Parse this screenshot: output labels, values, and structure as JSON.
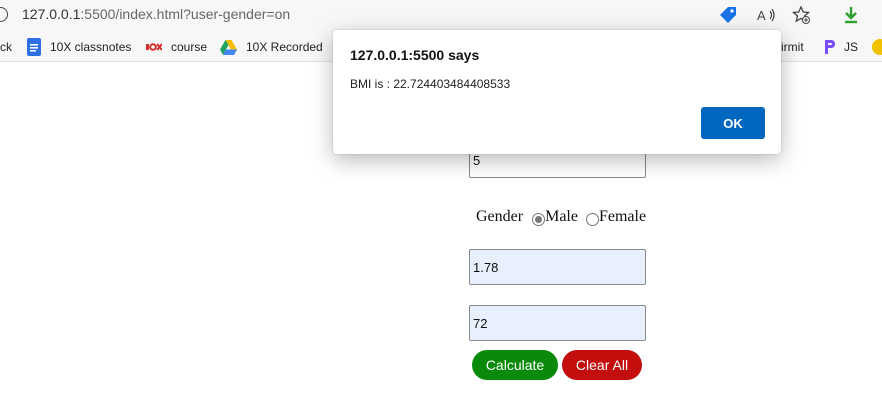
{
  "browser": {
    "url_host": "127.0.0.1",
    "url_rest": ":5500/index.html?user-gender=on"
  },
  "bookmarks": [
    {
      "label": "ck",
      "icon": "truncated-bookmark"
    },
    {
      "label": "10X classnotes",
      "icon": "google-docs-icon"
    },
    {
      "label": "course",
      "icon": "course-logo-icon"
    },
    {
      "label": "10X Recorded",
      "icon": "google-drive-icon"
    },
    {
      "label": "irmit",
      "icon": "truncated-bookmark"
    },
    {
      "label": "JS",
      "icon": "js-icon"
    }
  ],
  "form": {
    "age_value": "5",
    "gender_label": "Gender",
    "gender_options": [
      {
        "label": "Male",
        "checked": true
      },
      {
        "label": "Female",
        "checked": false
      }
    ],
    "height_value": "1.78",
    "weight_value": "72",
    "calculate_label": "Calculate",
    "clear_label": "Clear All"
  },
  "dialog": {
    "title": "127.0.0.1:5500 says",
    "message": "BMI is : 22.724403484408533",
    "ok_label": "OK"
  },
  "colors": {
    "calculate": "#0a8a0a",
    "clear": "#c40e0e",
    "ok": "#0067c0",
    "autofill": "#e8f0fe"
  }
}
